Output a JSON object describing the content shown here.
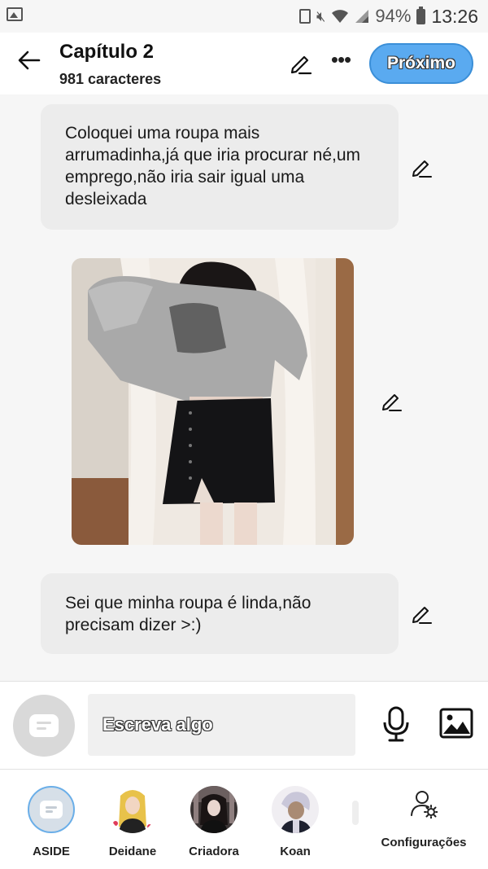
{
  "status_bar": {
    "battery": "94%",
    "time": "13:26"
  },
  "header": {
    "title": "Capítulo 2",
    "char_count": "981 caracteres",
    "next_label": "Próximo"
  },
  "messages": [
    {
      "type": "text",
      "text": "Coloquei uma roupa mais arrumadinha,já que iria procurar né,um emprego,não iria sair igual uma desleixada"
    },
    {
      "type": "image"
    },
    {
      "type": "text",
      "text": "Sei que minha roupa é linda,não precisam dizer >:)"
    }
  ],
  "composer": {
    "placeholder": "Escreva algo"
  },
  "bottom_nav": {
    "items": [
      {
        "label": "ASIDE"
      },
      {
        "label": "Deidane"
      },
      {
        "label": "Criadora"
      },
      {
        "label": "Koan"
      },
      {
        "label": "Configurações"
      }
    ]
  },
  "colors": {
    "accent": "#5aaaf0",
    "bubble": "#ececec",
    "background": "#f6f6f6"
  }
}
